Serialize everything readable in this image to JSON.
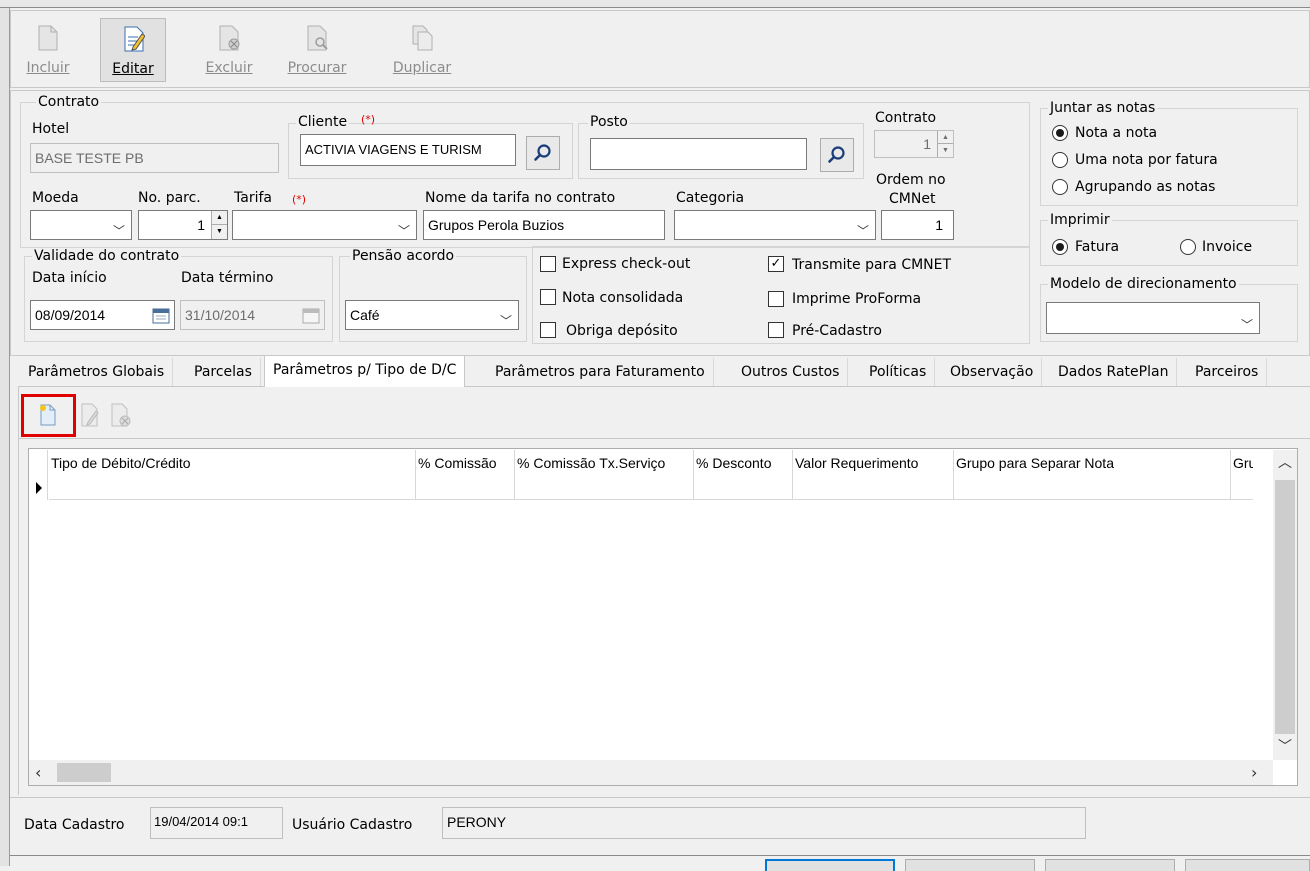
{
  "toolbar": {
    "buttons": [
      {
        "label": "Incluir",
        "enabled": false
      },
      {
        "label": "Editar",
        "enabled": true
      },
      {
        "label": "Excluir",
        "enabled": false
      },
      {
        "label": "Procurar",
        "enabled": false
      },
      {
        "label": "Duplicar",
        "enabled": false
      }
    ]
  },
  "contract": {
    "group_title": "Contrato",
    "hotel_label": "Hotel",
    "hotel_value": "BASE TESTE PB",
    "cliente_label": "Cliente",
    "required_mark": "(*)",
    "cliente_value": "ACTIVIA VIAGENS E TURISM",
    "posto_label": "Posto",
    "posto_value": "",
    "contrato_label": "Contrato",
    "contrato_value": "1",
    "moeda_label": "Moeda",
    "moeda_value": "",
    "parc_label": "No. parc.",
    "parc_value": "1",
    "tarifa_label": "Tarifa",
    "tarifa_value": "",
    "nome_tarifa_label": "Nome da tarifa no contrato",
    "nome_tarifa_value": "Grupos Perola Buzios",
    "categoria_label": "Categoria",
    "categoria_value": "",
    "ordem_label_1": "Ordem no",
    "ordem_label_2": "CMNet",
    "ordem_value": "1"
  },
  "validity": {
    "group_title": "Validade do contrato",
    "start_label": "Data início",
    "start_value": "08/09/2014",
    "end_label": "Data término",
    "end_value": "31/10/2014"
  },
  "pensao": {
    "group_title": "Pensão acordo",
    "value": "Café"
  },
  "options": [
    {
      "label": "Express check-out",
      "checked": false
    },
    {
      "label": "Transmite para CMNET",
      "checked": true
    },
    {
      "label": "Nota consolidada",
      "checked": false
    },
    {
      "label": "Imprime ProForma",
      "checked": false
    },
    {
      "label": "Obriga depósito",
      "checked": false
    },
    {
      "label": "Pré-Cadastro",
      "checked": false
    }
  ],
  "juntar": {
    "group_title": "Juntar as notas",
    "options": [
      "Nota a nota",
      "Uma nota por fatura",
      "Agrupando as notas"
    ],
    "selected": 0
  },
  "imprimir": {
    "group_title": "Imprimir",
    "options": [
      "Fatura",
      "Invoice"
    ],
    "selected": 0
  },
  "modelo": {
    "group_title": "Modelo de direcionamento",
    "value": ""
  },
  "tabs": [
    "Parâmetros Globais",
    "Parcelas",
    "Parâmetros p/ Tipo de D/C",
    "Parâmetros para Faturamento",
    "Outros Custos",
    "Políticas",
    "Observação",
    "Dados RatePlan",
    "Parceiros"
  ],
  "active_tab": 2,
  "grid": {
    "columns": [
      "Tipo de Débito/Crédito",
      "% Comissão",
      "% Comissão Tx.Serviço",
      "% Desconto",
      "Valor Requerimento",
      "Grupo para Separar Nota",
      "Grup"
    ],
    "rows": []
  },
  "footer": {
    "data_cadastro_label": "Data Cadastro",
    "data_cadastro_value": "19/04/2014 09:1",
    "usuario_label": "Usuário Cadastro",
    "usuario_value": "PERONY"
  },
  "colors": {
    "highlight": "#e00000",
    "accent": "#0078d7"
  }
}
